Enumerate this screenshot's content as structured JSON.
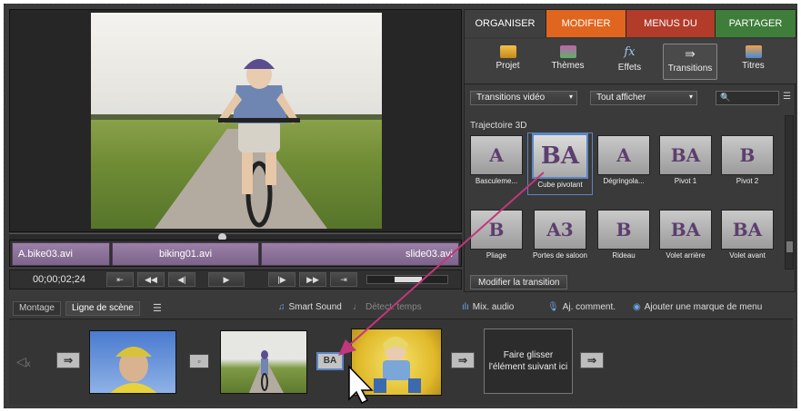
{
  "colors": {
    "tab_organiser": "#3f3f3f",
    "tab_modifier": "#e0661f",
    "tab_menus": "#c0392b",
    "tab_partager": "#3f7d3a",
    "accent_select": "#5a86c5",
    "arrow_magenta": "#c2377a"
  },
  "top_tabs": [
    {
      "label": "ORGANISER"
    },
    {
      "label": "MODIFIER"
    },
    {
      "label": "MENUS DU DISQUE"
    },
    {
      "label": "PARTAGER"
    }
  ],
  "categories": [
    {
      "label": "Projet",
      "icon": "project-icon"
    },
    {
      "label": "Thèmes",
      "icon": "themes-icon"
    },
    {
      "label": "Effets",
      "icon": "fx-icon"
    },
    {
      "label": "Transitions",
      "icon": "transitions-icon"
    },
    {
      "label": "Titres",
      "icon": "titles-icon"
    }
  ],
  "filters": {
    "type_select": "Transitions vidéo",
    "show_select": "Tout afficher"
  },
  "section_title": "Trajectoire 3D",
  "transitions": [
    {
      "label": "Basculeme...",
      "glyph": "A"
    },
    {
      "label": "Cube pivotant",
      "glyph": "BA"
    },
    {
      "label": "Dégringola...",
      "glyph": "A"
    },
    {
      "label": "Pivot 1",
      "glyph": "BA"
    },
    {
      "label": "Pivot 2",
      "glyph": "B"
    },
    {
      "label": "Pliage",
      "glyph": "B"
    },
    {
      "label": "Portes de saloon",
      "glyph": "A3"
    },
    {
      "label": "Rideau",
      "glyph": "B"
    },
    {
      "label": "Volet arrière",
      "glyph": "BA"
    },
    {
      "label": "Volet avant",
      "glyph": "BA"
    }
  ],
  "modify_button": "Modifier la transition",
  "clips": [
    {
      "label": "A.bike03.avi"
    },
    {
      "label": "biking01.avi"
    },
    {
      "label": "slide03.avi"
    }
  ],
  "transport": {
    "timecode": "00;00;02;24"
  },
  "bottom_toolbar": {
    "montage": "Montage",
    "ligne_scene": "Ligne de scène",
    "smart_sound": "Smart Sound",
    "detect_temps": "Détect. temps",
    "mix_audio": "Mix. audio",
    "aj_comment": "Aj. comment.",
    "menu_marker": "Ajouter une marque de menu"
  },
  "dropzone": "Faire glisser l'élément suivant ici",
  "scene_transition_glyph": "BA"
}
